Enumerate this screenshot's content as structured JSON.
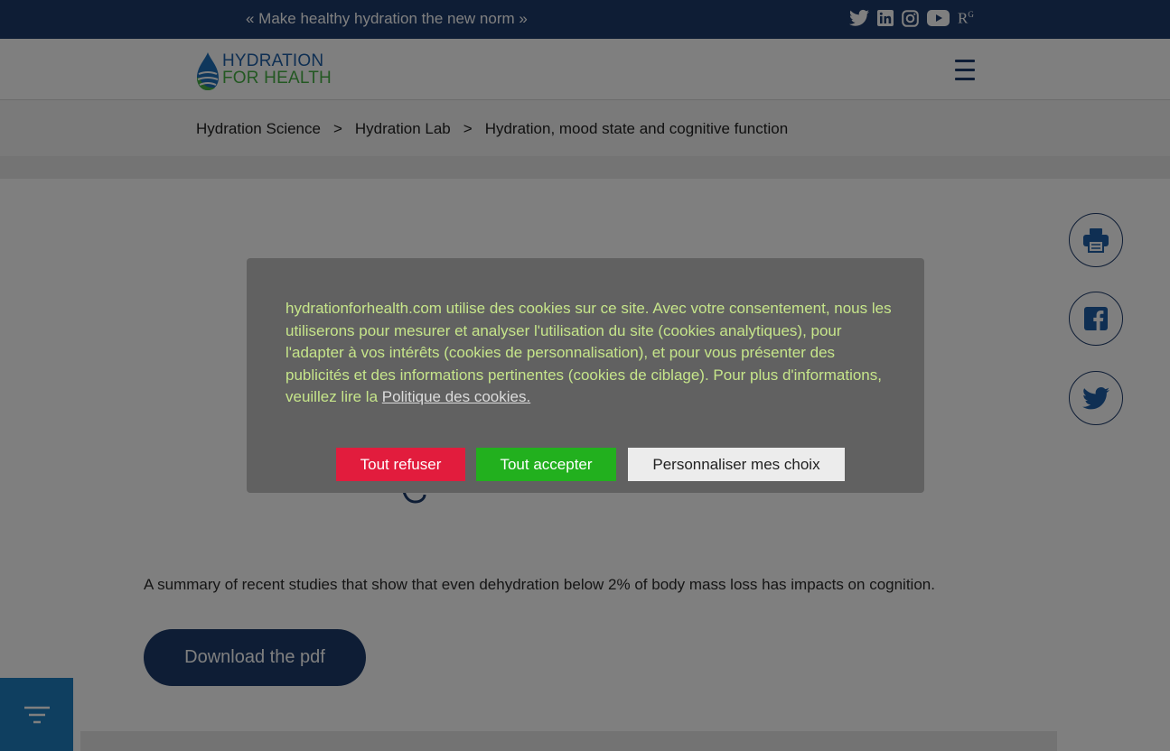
{
  "topbar": {
    "slogan": "« Make healthy hydration the new norm »",
    "socials": [
      "twitter-icon",
      "linkedin-icon",
      "instagram-icon",
      "youtube-icon",
      "researchgate-icon"
    ],
    "researchgate_label": "R",
    "researchgate_sup": "G"
  },
  "header": {
    "logo_line1": "HYDRATION",
    "logo_line2": "FOR HEALTH"
  },
  "breadcrumb": {
    "items": [
      "Hydration Science",
      "Hydration Lab",
      "Hydration, mood state and cognitive function"
    ],
    "separator": ">"
  },
  "share": {
    "icons": [
      "print-icon",
      "facebook-icon",
      "twitter-icon"
    ]
  },
  "main": {
    "summary": "A summary of recent studies that show that even dehydration below 2% of body mass loss has impacts on cognition.",
    "download_label": "Download the pdf"
  },
  "cookie_banner": {
    "text": "hydrationforhealth.com utilise des cookies sur ce site. Avec votre consentement, nous les utiliserons pour mesurer et analyser l'utilisation du site (cookies analytiques), pour l'adapter à vos intérêts (cookies de personnalisation), et pour vous présenter des publicités et des informations pertinentes (cookies de ciblage). Pour plus d'informations, veuillez lire la",
    "policy_link": "Politique des cookies.",
    "refuse_label": "Tout refuser",
    "accept_label": "Tout accepter",
    "customize_label": "Personnaliser mes choix"
  },
  "colors": {
    "navy": "#1c3a6b",
    "cookie_text": "#c6e58a",
    "refuse": "#e21c3d",
    "accept": "#22b01e",
    "filter": "#1f7fc1"
  }
}
